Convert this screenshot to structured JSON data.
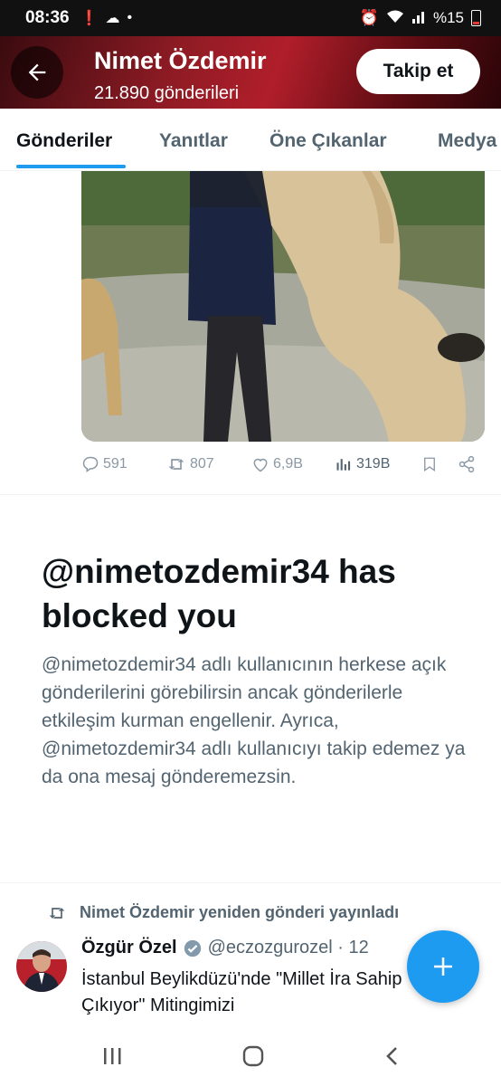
{
  "status_bar": {
    "time": "08:36",
    "battery": "%15"
  },
  "header": {
    "name": "Nimet Özdemir",
    "posts_count": "21.890 gönderileri",
    "follow_label": "Takip et"
  },
  "tabs": [
    {
      "label": "Gönderiler",
      "active": true
    },
    {
      "label": "Yanıtlar"
    },
    {
      "label": "Öne Çıkanlar"
    },
    {
      "label": "Medya"
    }
  ],
  "post_actions": {
    "replies": "591",
    "reposts": "807",
    "likes": "6,9B",
    "views": "319B"
  },
  "blocked": {
    "title": "@nimetozdemir34 has blocked you",
    "description": "@nimetozdemir34 adlı kullanıcının herkese açık gönderilerini görebilirsin ancak gönderilerle etkileşim kurman engellenir. Ayrıca, @nimetozdemir34 adlı kullanıcıyı takip edemez ya da ona mesaj gönderemezsin."
  },
  "repost": {
    "context": "Nimet Özdemir yeniden gönderi yayınladı",
    "author": "Özgür Özel",
    "handle": "@eczozgurozel · 12",
    "text": "İstanbul Beylikdüzü'nde \"Millet İra Sahip Çıkıyor\" Mitingimizi"
  },
  "colors": {
    "accent": "#1d9bf0",
    "header_red": "#b01e2a",
    "muted": "#536471"
  }
}
